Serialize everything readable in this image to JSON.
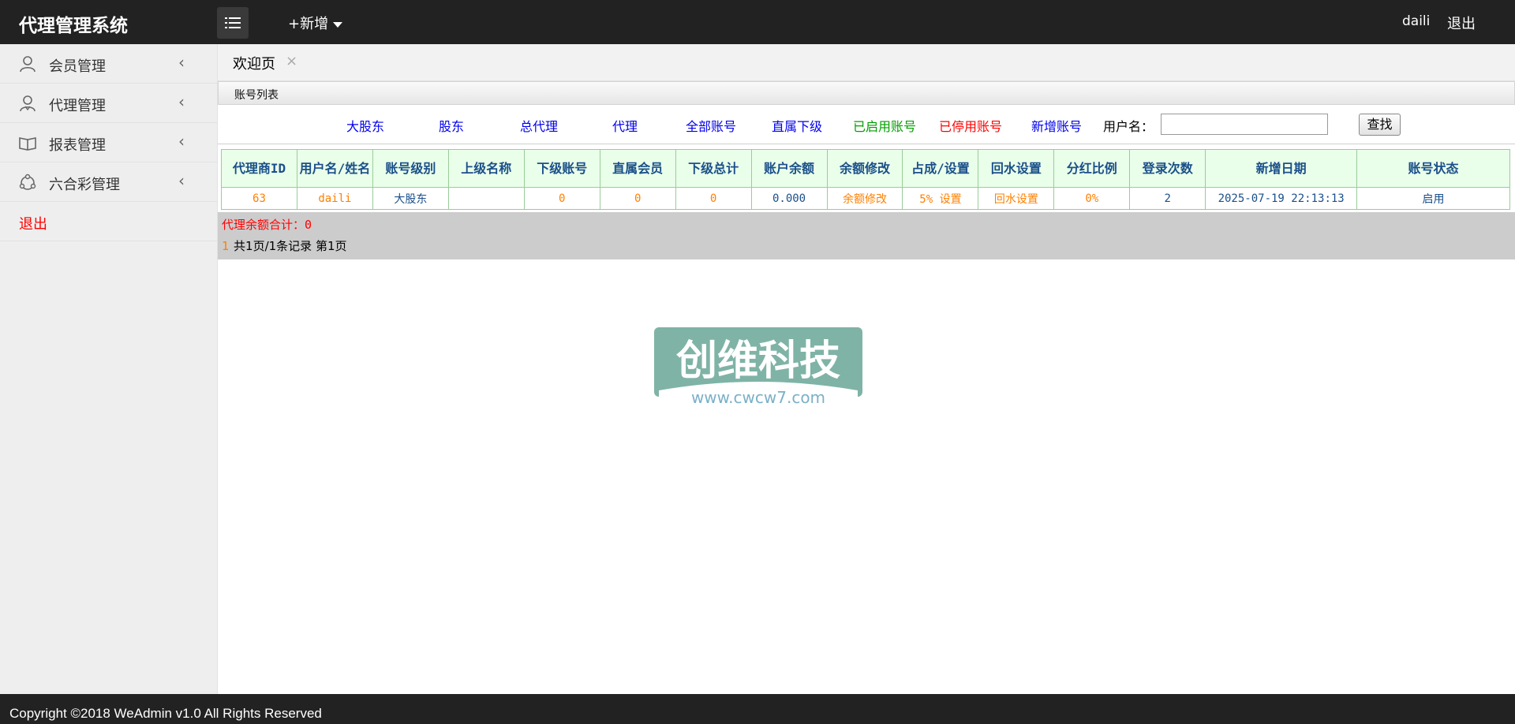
{
  "app": {
    "title": "代理管理系统",
    "add_new": "+新增",
    "user": "daili",
    "logout": "退出"
  },
  "sidebar": {
    "items": [
      {
        "label": "会员管理",
        "icon": "user-icon"
      },
      {
        "label": "代理管理",
        "icon": "agent-icon"
      },
      {
        "label": "报表管理",
        "icon": "report-icon"
      },
      {
        "label": "六合彩管理",
        "icon": "lottery-icon"
      }
    ],
    "logout": "退出"
  },
  "tabs": [
    {
      "label": "欢迎页",
      "close": "×"
    }
  ],
  "panel": {
    "title": "账号列表"
  },
  "filters": {
    "links": [
      "大股东",
      "股东",
      "总代理",
      "代理",
      "全部账号",
      "直属下级",
      "已启用账号",
      "已停用账号",
      "新增账号"
    ],
    "username_label": "用户名：",
    "username_value": "",
    "search_label": "查找"
  },
  "table": {
    "headers": [
      "代理商ID",
      "用户名/姓名",
      "账号级别",
      "上级名称",
      "下级账号",
      "直属会员",
      "下级总计",
      "账户余额",
      "余额修改",
      "占成/设置",
      "回水设置",
      "分红比例",
      "登录次数",
      "新增日期",
      "账号状态"
    ],
    "rows": [
      [
        "63",
        "daili",
        "大股东",
        "",
        "0",
        "0",
        "0",
        "0.000",
        "余额修改",
        "5% 设置",
        "回水设置",
        "0%",
        "2",
        "2025-07-19 22:13:13",
        "启用"
      ]
    ]
  },
  "summary": {
    "balance_total": "代理余额合计：0",
    "page_num": "1",
    "page_info": "共1页/1条记录 第1页"
  },
  "watermark": {
    "main": "创维科技",
    "url": "www.cwcw7.com"
  },
  "footer": {
    "copyright": "Copyright ©2018 WeAdmin v1.0 All Rights Reserved"
  },
  "colors": {
    "topbar": "#222222",
    "sidebar": "#eeeeee",
    "link": "#0000ee",
    "enabled": "#00a000",
    "disabled": "#ff0000",
    "cell": "#ff8000",
    "header_text": "#1a4f8a",
    "header_bg": "#eaffea"
  }
}
